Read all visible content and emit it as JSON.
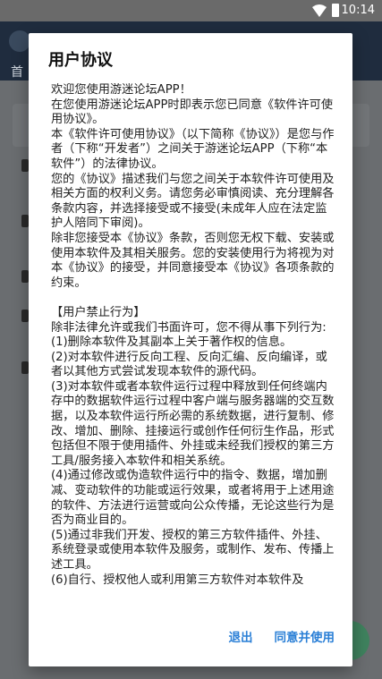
{
  "status_bar": {
    "time": "10:14"
  },
  "background_app": {
    "tab_label": "首"
  },
  "dialog": {
    "title": "用户协议",
    "body": "欢迎您使用游迷论坛APP！\n在您使用游迷论坛APP时即表示您已同意《软件许可使用协议》。\n本《软件许可使用协议》（以下简称《协议》）是您与作者（下称“开发者”）之间关于游迷论坛APP（下称“本软件”）的法律协议。\n您的《协议》描述我们与您之间关于本软件许可使用及相关方面的权利义务。请您务必审慎阅读、充分理解各条款内容，并选择接受或不接受(未成年人应在法定监护人陪同下审阅)。\n除非您接受本《协议》条款，否则您无权下载、安装或使用本软件及其相关服务。您的安装使用行为将视为对本《协议》的接受，并同意接受本《协议》各项条款的约束。\n\n【用户禁止行为】\n除非法律允许或我们书面许可，您不得从事下列行为:\n(1)删除本软件及其副本上关于著作权的信息。\n(2)对本软件进行反向工程、反向汇编、反向编译，或者以其他方式尝试发现本软件的源代码。\n(3)对本软件或者本软件运行过程中释放到任何终端内存中的数据软件运行过程中客户端与服务器端的交互数据，以及本软件运行所必需的系统数据，进行复制、修改、增加、删除、挂接运行或创作任何衍生作品，形式包括但不限于使用插件、外挂或未经我们授权的第三方工具/服务接入本软件和相关系统。\n(4)通过修改或伪造软件运行中的指令、数据，增加删减、变动软件的功能或运行效果，或者将用于上述用途的软件、方法进行运营或向公众传播，无论这些行为是否为商业目的。\n(5)通过非我们开发、授权的第三方软件插件、外挂、系统登录或使用本软件及服务，或制作、发布、传播上述工具。\n(6)自行、授权他人或利用第三方软件对本软件及",
    "buttons": {
      "exit": "退出",
      "agree": "同意并使用"
    }
  }
}
